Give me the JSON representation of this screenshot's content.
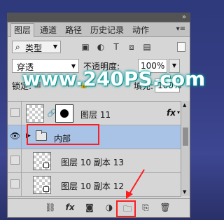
{
  "tabs": [
    {
      "label": "图层",
      "active": true
    },
    {
      "label": "通道",
      "active": false
    },
    {
      "label": "路径",
      "active": false
    },
    {
      "label": "历史记录",
      "active": false
    },
    {
      "label": "动作",
      "active": false
    }
  ],
  "filter": {
    "label": "类型"
  },
  "blend": {
    "value": "穿透"
  },
  "opacity": {
    "label": "不透明度:",
    "value": "100%"
  },
  "lock": {
    "label": "锁定:"
  },
  "fill": {
    "label": "填充:",
    "value": "100%"
  },
  "watermark": "www.240PS.com",
  "layers": [
    {
      "name": "图层 11",
      "visible": false,
      "fx": "fx"
    },
    {
      "name": "内部",
      "visible": true,
      "type": "group"
    },
    {
      "name": "图层 10 副本 13",
      "visible": false
    },
    {
      "name": "图层 10 副本 12",
      "visible": false
    }
  ],
  "colors": {
    "highlight": "#a9c3e6",
    "annotation": "#ff1e1e",
    "watermark_glow": "#00a0a0"
  }
}
